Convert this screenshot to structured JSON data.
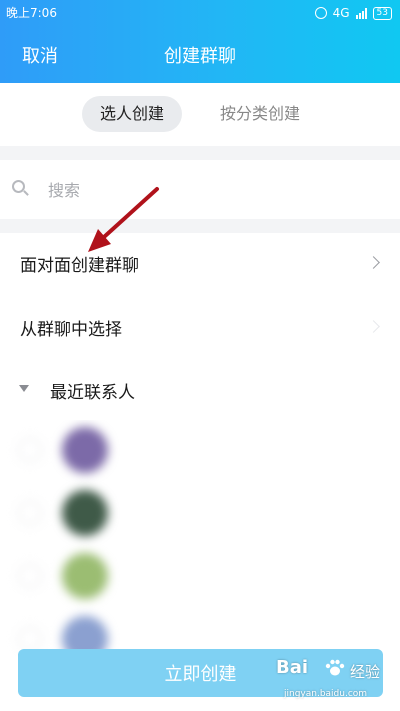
{
  "status_bar": {
    "time": "晚上7:06",
    "network": "4G",
    "battery": "53"
  },
  "header": {
    "cancel_label": "取消",
    "title": "创建群聊"
  },
  "tabs": [
    {
      "label": "选人创建",
      "active": true
    },
    {
      "label": "按分类创建",
      "active": false
    }
  ],
  "search": {
    "placeholder": "搜索"
  },
  "options": [
    {
      "label": "面对面创建群聊"
    },
    {
      "label": "从群聊中选择"
    }
  ],
  "recent": {
    "label": "最近联系人"
  },
  "contacts": [
    {
      "name": "",
      "avatar_color": "#7c6aa8"
    },
    {
      "name": "",
      "avatar_color": "#3f5a48"
    },
    {
      "name": "",
      "avatar_color": "#9bbd72"
    },
    {
      "name": "",
      "avatar_color": "#8ba0d0"
    }
  ],
  "create_button": {
    "label": "立即创建"
  },
  "watermark": {
    "brand": "Bai",
    "sub": "经验",
    "url": "jingyan.baidu.com"
  },
  "colors": {
    "header_start": "#2f9cf8",
    "header_end": "#10c8f2",
    "button": "#7fd1f3",
    "annotation_arrow": "#b0121b"
  }
}
